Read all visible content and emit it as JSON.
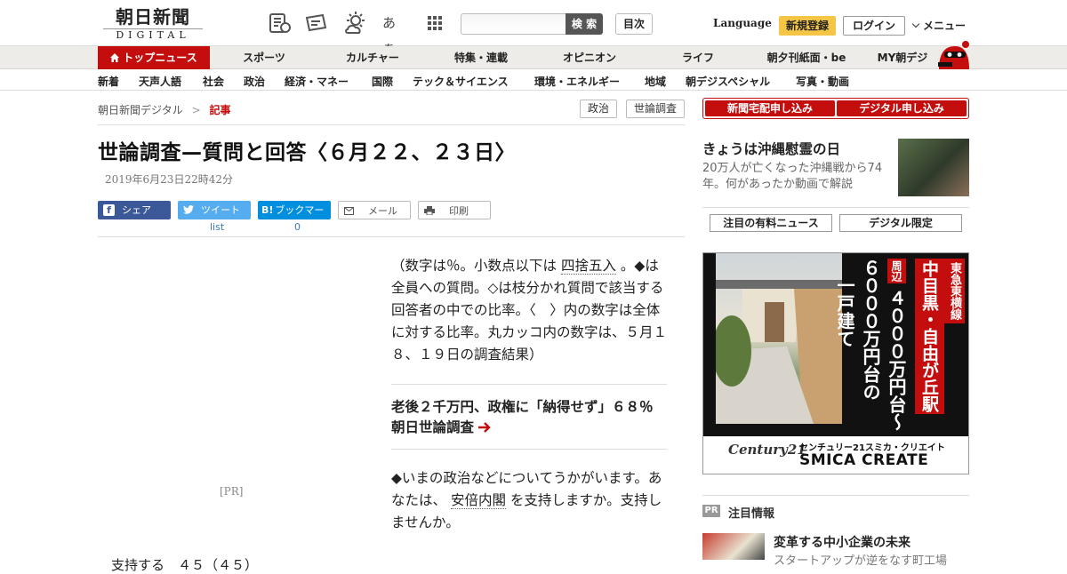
{
  "header": {
    "logo_main": "朝日新聞",
    "logo_sub": "DIGITAL",
    "kana_icon_text": "あぁ",
    "search_button": "検 索",
    "toc_button": "目次",
    "language": "Language",
    "signup": "新規登録",
    "login": "ログイン",
    "menu": "メニュー"
  },
  "nav_primary": [
    "トップニュース",
    "スポーツ",
    "カルチャー",
    "特集・連載",
    "オピニオン",
    "ライフ",
    "朝夕刊紙面・be",
    "MY朝デジ"
  ],
  "nav_secondary": [
    "新着",
    "天声人語",
    "社会",
    "政治",
    "経済・マネー",
    "国際",
    "テック＆サイエンス",
    "環境・エネルギー",
    "地域",
    "朝デジスペシャル",
    "写真・動画"
  ],
  "breadcrumb": {
    "home": "朝日新聞デジタル",
    "sep": ">",
    "current": "記事"
  },
  "tags": [
    "政治",
    "世論調査"
  ],
  "article": {
    "headline": "世論調査—質問と回答〈６月２２、２３日〉",
    "timestamp": "2019年6月23日22時42分",
    "share": {
      "facebook": "シェア",
      "twitter": "ツイート",
      "twitter_count": "list",
      "hatena": "ブックマーク",
      "hatena_icon": "B!",
      "hatena_count": "0",
      "mail": "メール",
      "print": "印刷"
    },
    "pr_label": "[PR]",
    "intro_1": "（数字は％。小数点以下は",
    "intro_link": "四捨五入",
    "intro_2": "。◆は全員への質問。◇は枝分かれ質問で該当する回答者の中での比率。〈　〉内の数字は全体に対する比率。丸カッコ内の数字は、５月１８、１９日の調査結果）",
    "related": "老後２千万円、政権に「納得せず」６８％　朝日世論調査",
    "question_1": "◆いまの政治などについてうかがいます。あなたは、",
    "question_link": "安倍内閣",
    "question_2": "を支持しますか。支持しませんか。",
    "answer_partial": "支持する　４５（４５）"
  },
  "sidebar": {
    "delivery_paper": "新聞宅配申し込み",
    "delivery_digital": "デジタル申し込み",
    "promo_title": "きょうは沖縄慰霊の日",
    "promo_desc": "20万人が亡くなった沖縄戦から74年。何があったか動画で解説",
    "tab_paid": "注目の有料ニュース",
    "tab_digital": "デジタル限定",
    "ad": {
      "line_label": "東急東横線",
      "station": "中目黒・自由が丘駅",
      "area": "周辺",
      "price_1": "４０００万円台〜",
      "price_2": "６０００万円台の",
      "house": "一戸建て",
      "brand_logo": "Century21",
      "brand_jp": "センチュリー21スミカ・クリエイト",
      "brand_en": "SMICA CREATE"
    },
    "pr_badge": "PR",
    "featured_heading": "注目情報",
    "featured_title": "変革する中小企業の未来",
    "featured_desc": "スタートアップが逆をなす町工場"
  },
  "colors": {
    "accent_red": "#c40d0d",
    "signup_yellow": "#f5c545",
    "facebook": "#3b5998",
    "twitter": "#55acee",
    "hatena": "#008fde"
  }
}
